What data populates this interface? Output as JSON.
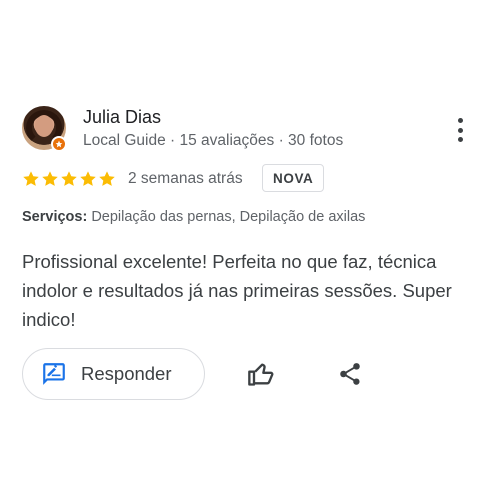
{
  "reviewer": {
    "name": "Julia Dias",
    "meta": "Local Guide · 15 avaliações · 30 fotos",
    "avatar_icon": "profile-photo",
    "badge_icon": "local-guide-star-icon",
    "badge_color": "#e8710a"
  },
  "rating": {
    "stars": 5,
    "max": 5,
    "star_color": "#fbbc04"
  },
  "time_ago": "2 semanas atrás",
  "new_badge": "NOVA",
  "services": {
    "label": "Serviços:",
    "value": "Depilação das pernas, Depilação de axilas"
  },
  "review_text": "Profissional excelente! Perfeita no que faz, técnica indolor e resultados já nas primeiras sessões. Super indico!",
  "actions": {
    "reply_label": "Responder",
    "reply_icon": "reply-icon",
    "like_icon": "thumbs-up-icon",
    "share_icon": "share-icon",
    "more_icon": "more-vertical-icon",
    "accent_color": "#1a73e8"
  }
}
